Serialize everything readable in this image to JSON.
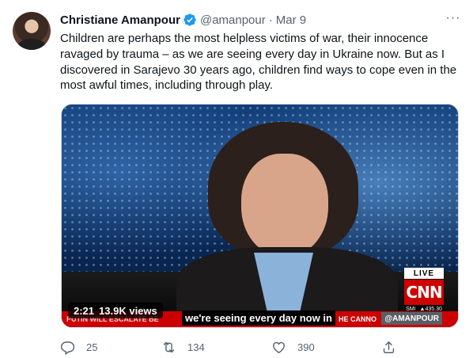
{
  "author": {
    "name": "Christiane Amanpour",
    "handle": "@amanpour",
    "separator": "·",
    "date": "Mar 9"
  },
  "tweet_text": "Children are perhaps the most helpless victims of war, their innocence ravaged by trauma – as we are seeing every day in Ukraine now. But as I discovered in Sarajevo 30 years ago, children find ways to cope even in the most awful times, including through play.",
  "video": {
    "duration": "2:21",
    "views": "13.9K views",
    "caption": "we're seeing every day now in",
    "live_label": "LIVE",
    "network_logo": "CNN",
    "bug_left": "SMI",
    "bug_right": "▲435.30",
    "ticker_left": "PUTIN WILL ESCALATE BE",
    "ticker_right": "HE CANNO",
    "ticker_handle": "@AMANPOUR"
  },
  "actions": {
    "replies": "25",
    "retweets": "134",
    "likes": "390"
  },
  "colors": {
    "verified": "#1d9bf0",
    "muted_text": "#536471",
    "cnn_red": "#cc0000"
  },
  "icons": [
    "verified-badge-icon",
    "more-options-icon",
    "reply-icon",
    "retweet-icon",
    "like-icon",
    "share-icon"
  ]
}
